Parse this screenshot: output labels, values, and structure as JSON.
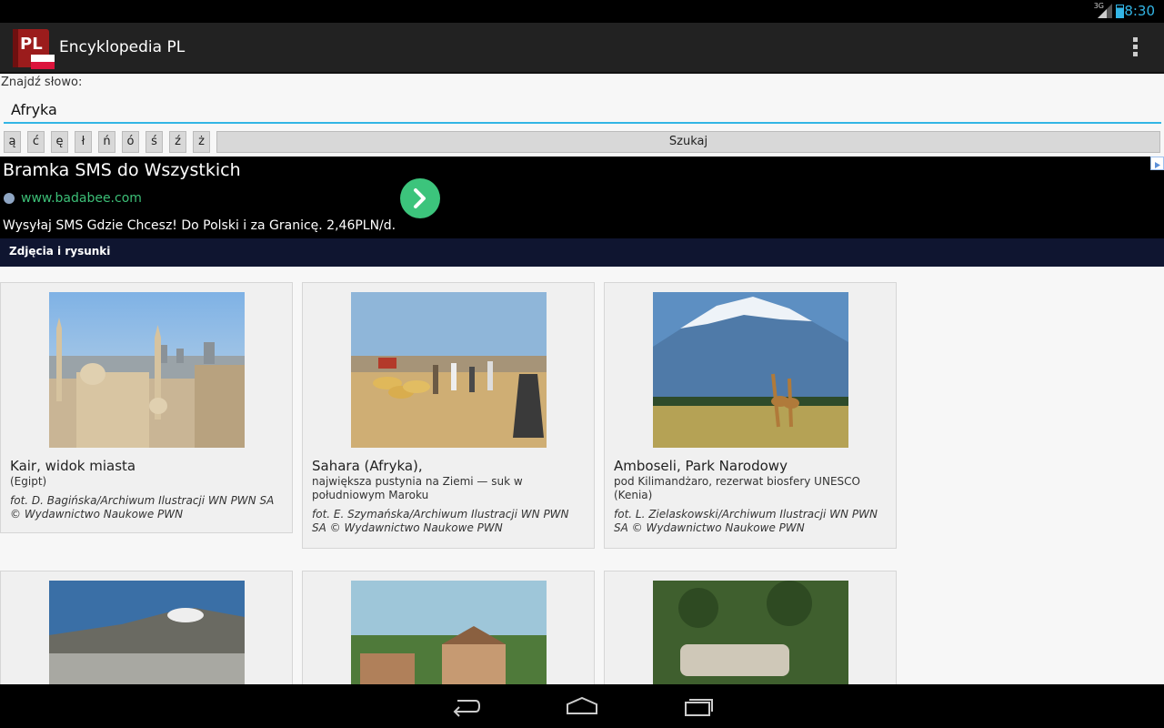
{
  "status_bar": {
    "time": "8:30",
    "network": "3G"
  },
  "action_bar": {
    "title": "Encyklopedia PL",
    "icon_text": "PL"
  },
  "search": {
    "label": "Znajdź słowo:",
    "value": "Afryka",
    "special_chars": [
      "ą",
      "ć",
      "ę",
      "ł",
      "ń",
      "ó",
      "ś",
      "ź",
      "ż"
    ],
    "button_label": "Szukaj"
  },
  "ad": {
    "title": "Bramka SMS do Wszystkich",
    "url": "www.badabee.com",
    "description": "Wysyłaj SMS Gdzie Chcesz! Do Polski i za Granicę. 2,46PLN/d."
  },
  "section": {
    "title": "Zdjęcia i rysunki"
  },
  "cards": [
    {
      "title": "Kair, widok miasta",
      "description": "(Egipt)",
      "credit": "fot. D. Bagińska/Archiwum Ilustracji WN PWN SA © Wydawnictwo Naukowe PWN"
    },
    {
      "title": "Sahara (Afryka),",
      "description": "największa pustynia na Ziemi — suk w południowym Maroku",
      "credit": "fot. E. Szymańska/Archiwum Ilustracji WN PWN SA © Wydawnictwo Naukowe PWN"
    },
    {
      "title": "Amboseli, Park Narodowy",
      "description": "pod Kilimandżaro, rezerwat biosfery UNESCO (Kenia)",
      "credit": "fot. L. Zielaskowski/Archiwum Ilustracji WN PWN SA © Wydawnictwo Naukowe PWN"
    }
  ],
  "icons": {
    "overflow": "overflow-menu-icon",
    "back": "back-icon",
    "home": "home-icon",
    "recents": "recents-icon",
    "ad_go": "chevron-right-icon",
    "ad_info": "ad-info-icon"
  },
  "colors": {
    "accent": "#33b5e5",
    "ad_url": "#3cbf77",
    "section_header": "#0f1530"
  }
}
